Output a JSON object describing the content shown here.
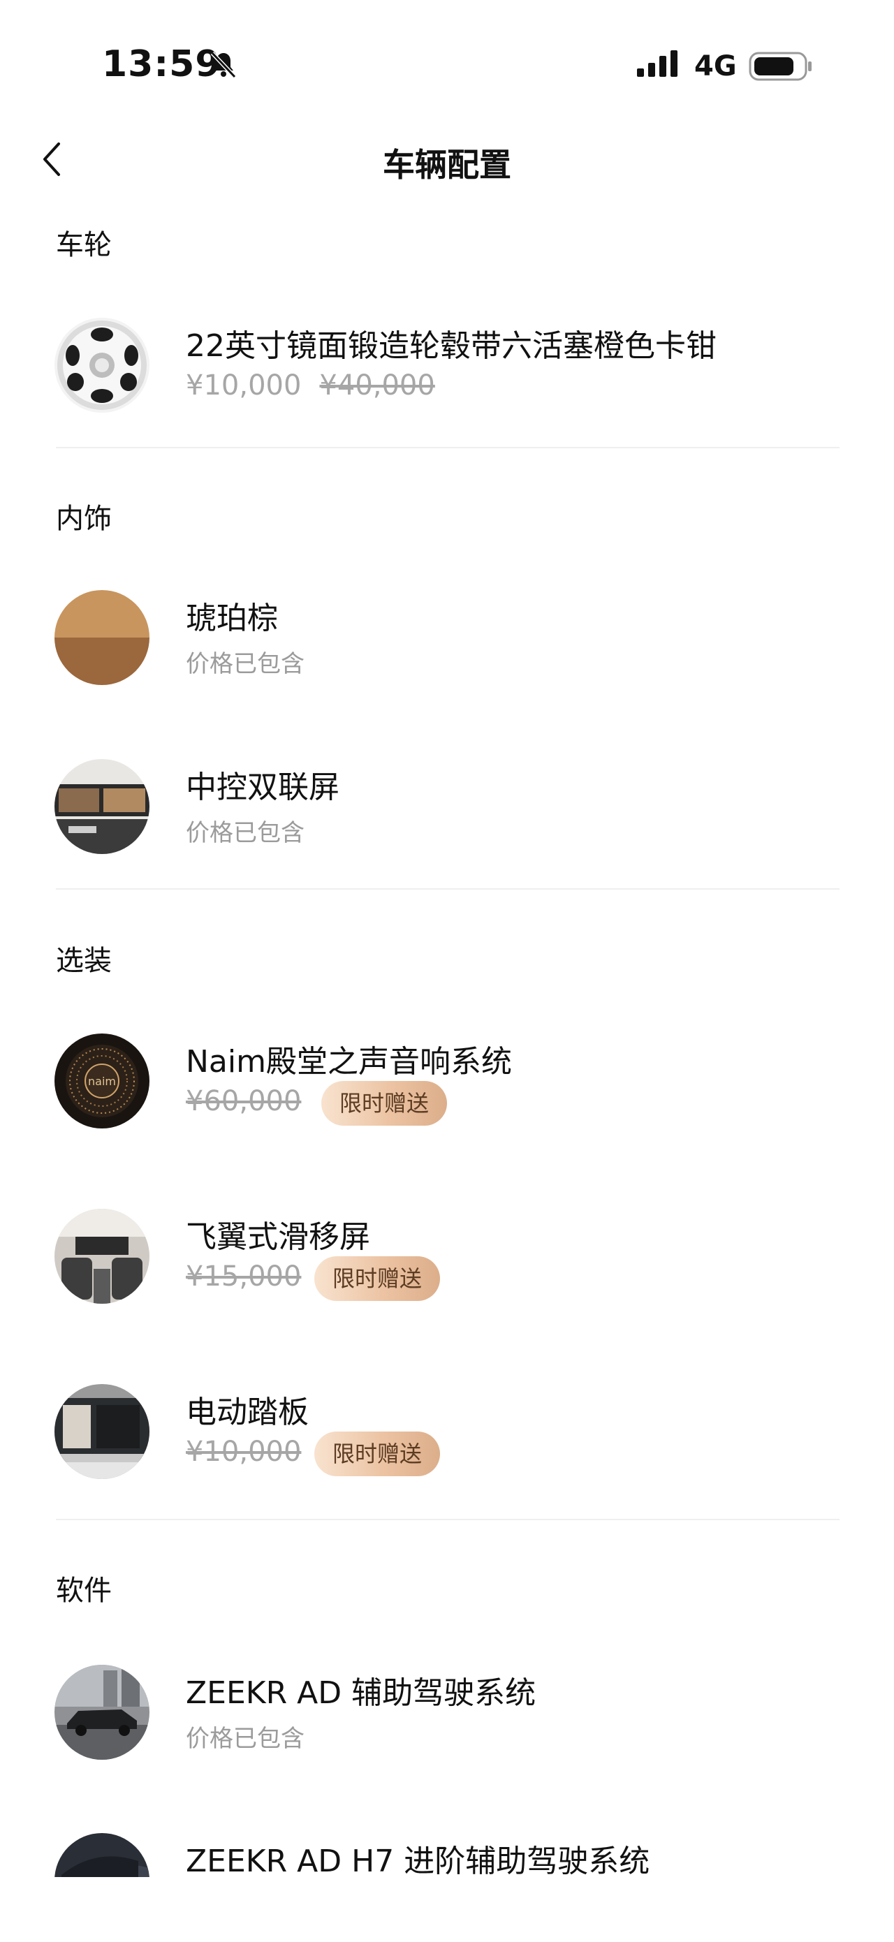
{
  "status_bar": {
    "time": "13:59",
    "network": "4G",
    "icons": [
      "bell-off-icon",
      "signal-icon",
      "battery-icon"
    ]
  },
  "nav": {
    "back_icon": "chevron-left-icon",
    "title": "车辆配置"
  },
  "sections": {
    "wheels": {
      "title": "车轮",
      "items": [
        {
          "name": "22英寸镜面锻造轮毂带六活塞橙色卡钳",
          "price": "¥10,000",
          "original_price": "¥40,000",
          "icon": "wheel-image"
        }
      ]
    },
    "interior": {
      "title": "内饰",
      "items": [
        {
          "name": "琥珀棕",
          "note": "价格已包含",
          "icon": "amber-brown-swatch"
        },
        {
          "name": "中控双联屏",
          "note": "价格已包含",
          "icon": "dual-screen-image"
        }
      ]
    },
    "options": {
      "title": "选装",
      "items": [
        {
          "name": "Naim殿堂之声音响系统",
          "original_price": "¥60,000",
          "badge": "限时赠送",
          "icon": "naim-speaker-image"
        },
        {
          "name": "飞翼式滑移屏",
          "original_price": "¥15,000",
          "badge": "限时赠送",
          "icon": "cabin-screen-image"
        },
        {
          "name": "电动踏板",
          "original_price": "¥10,000",
          "badge": "限时赠送",
          "icon": "power-step-image"
        }
      ]
    },
    "software": {
      "title": "软件",
      "items": [
        {
          "name": "ZEEKR AD 辅助驾驶系统",
          "note": "价格已包含",
          "icon": "car-driving-image"
        },
        {
          "name": "ZEEKR AD H7 进阶辅助驾驶系统",
          "icon": "car-night-image"
        }
      ]
    }
  },
  "colors": {
    "badge_gradient_start": "#f8e3cf",
    "badge_gradient_end": "#dcae8a",
    "muted_text": "#9b9b9b",
    "divider": "#efefef"
  }
}
